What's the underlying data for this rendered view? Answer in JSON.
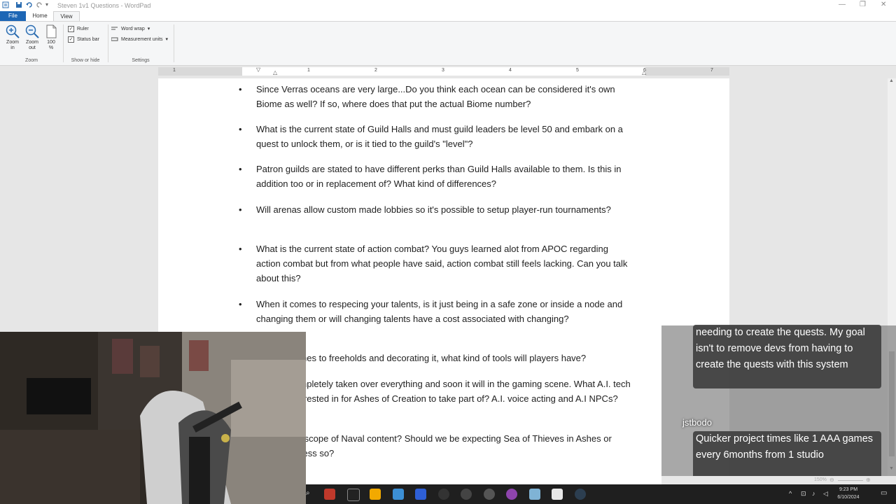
{
  "window": {
    "title": "Steven 1v1 Questions - WordPad"
  },
  "tabs": [
    "File",
    "Home",
    "View"
  ],
  "ribbon": {
    "zoom_in": "Zoom in",
    "zoom_out": "Zoom out",
    "zoom_100": "100 %",
    "group_zoom": "Zoom",
    "ruler": "Ruler",
    "status_bar": "Status bar",
    "group_show": "Show or hide",
    "word_wrap": "Word wrap",
    "measurement_units": "Measurement units",
    "group_settings": "Settings"
  },
  "ruler": {
    "numbers": [
      "1",
      "1",
      "2",
      "3",
      "4",
      "5",
      "6",
      "7"
    ]
  },
  "document": {
    "items": [
      "Since Verras oceans are very large...Do you think each ocean can be considered it's own Biome as well? If so, where does that put the actual Biome number?",
      "What is the current state of Guild Halls and must guild leaders be level 50 and embark on a quest to unlock them, or is it tied to the guild's \"level\"?",
      "Patron guilds are stated to have different perks than Guild Halls available to them. Is this in addition too or in replacement of? What kind of differences?",
      "Will arenas allow custom made lobbies so it's possible to setup player-run tournaments?",
      "What is the current state of action combat? You guys learned alot from APOC regarding action combat but from what people have said, action combat still feels lacking. Can you talk about this?",
      "When it comes to respecing your talents, is it just being in a safe zone or inside a node and changing them or will changing talents have a cost associated with changing?",
      "When it comes to freeholds and decorating it, what kind of tools will players have?",
      "A.I. has completely taken over everything and soon it will in the gaming scene. What A.I. tech are you interested in for Ashes of Creation to take part of? A.I. voice acting and A.I NPCs?",
      "What is the scope of Naval content? Should we be expecting Sea of Thieves in Ashes or something less so?"
    ]
  },
  "chat": {
    "message1": "needing to create the quests. My goal isn't to remove devs from having to create the quests with this system",
    "username": "jstbodo",
    "message2": "Quicker project times like 1 AAA games every 6months from 1 studio"
  },
  "status": {
    "zoom": "150%"
  },
  "taskbar": {
    "time": "9:23 PM",
    "date": "6/10/2024"
  },
  "colors": {
    "file_tab": "#1d66b5",
    "page": "#ffffff",
    "taskbar": "#1f1f1f"
  }
}
